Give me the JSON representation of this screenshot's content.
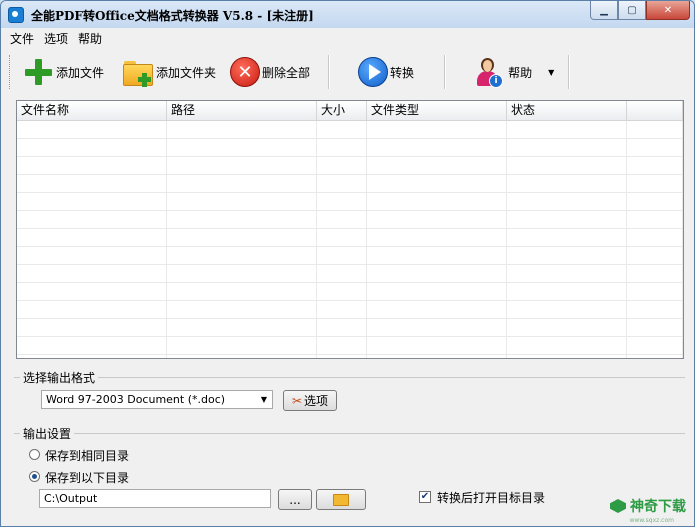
{
  "window": {
    "title": "全能PDF转Office文档格式转换器 V5.8  -  [未注册]",
    "controls": [
      "minimize",
      "maximize",
      "close"
    ]
  },
  "menu": [
    "文件",
    "选项",
    "帮助"
  ],
  "toolbar": {
    "add_file": "添加文件",
    "add_folder": "添加文件夹",
    "delete_all": "删除全部",
    "convert": "转换",
    "help": "帮助"
  },
  "file_table": {
    "columns": [
      "文件名称",
      "路径",
      "大小",
      "文件类型",
      "状态",
      ""
    ],
    "rows": []
  },
  "output_format": {
    "group_label": "选择输出格式",
    "selected": "Word 97-2003 Document (*.doc)",
    "options_button": "选项"
  },
  "output_settings": {
    "group_label": "输出设置",
    "radio_same_dir": "保存到相同目录",
    "radio_custom_dir": "保存到以下目录",
    "selected_radio": "custom",
    "path": "C:\\Output",
    "browse_button": "...",
    "open_after_label": "转换后打开目标目录",
    "open_after_checked": true
  },
  "watermark": {
    "text": "神奇下载",
    "sub": "www.sqxz.com"
  }
}
